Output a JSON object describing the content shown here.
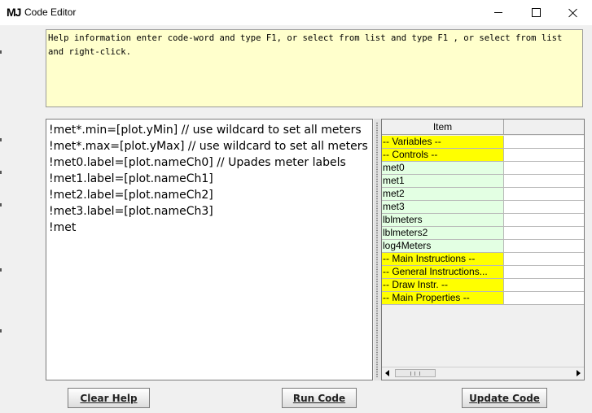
{
  "window": {
    "app_icon_text": "MJ",
    "title": "Code Editor"
  },
  "help": {
    "text": "Help information enter code-word and type F1, or select from list and type F1 , or select from list and right-click."
  },
  "editor": {
    "lines": [
      "!met*.min=[plot.yMin] // use wildcard to set all meters",
      "!met*.max=[plot.yMax] // use wildcard to set all meters",
      "!met0.label=[plot.nameCh0] // Upades meter labels",
      "!met1.label=[plot.nameCh1]",
      "!met2.label=[plot.nameCh2]",
      "!met3.label=[plot.nameCh3]",
      "!met"
    ]
  },
  "table": {
    "column_headers": [
      "Item",
      ""
    ],
    "rows": [
      {
        "item": "-- Variables --",
        "kind": "section",
        "value": ""
      },
      {
        "item": "-- Controls --",
        "kind": "section",
        "value": ""
      },
      {
        "item": "met0",
        "kind": "object",
        "value": ""
      },
      {
        "item": "met1",
        "kind": "object",
        "value": ""
      },
      {
        "item": "met2",
        "kind": "object",
        "value": ""
      },
      {
        "item": "met3",
        "kind": "object",
        "value": ""
      },
      {
        "item": "lblmeters",
        "kind": "object",
        "value": ""
      },
      {
        "item": "lblmeters2",
        "kind": "object",
        "value": ""
      },
      {
        "item": "log4Meters",
        "kind": "object",
        "value": ""
      },
      {
        "item": "-- Main Instructions --",
        "kind": "section",
        "value": ""
      },
      {
        "item": "-- General Instructions...",
        "kind": "section",
        "value": ""
      },
      {
        "item": "-- Draw Instr. --",
        "kind": "section",
        "value": ""
      },
      {
        "item": "-- Main Properties --",
        "kind": "section",
        "value": ""
      }
    ]
  },
  "buttons": {
    "clear_help": "Clear Help",
    "run_code": "Run Code",
    "update_code": "Update Code"
  },
  "colors": {
    "help_background": "#ffffcc",
    "section_row": "#ffff00",
    "object_row": "#e3ffe3"
  },
  "icons": {
    "minimize": "minimize-icon",
    "maximize": "maximize-icon",
    "close": "close-icon",
    "scroll_left": "arrow-left-icon",
    "scroll_right": "arrow-right-icon"
  }
}
